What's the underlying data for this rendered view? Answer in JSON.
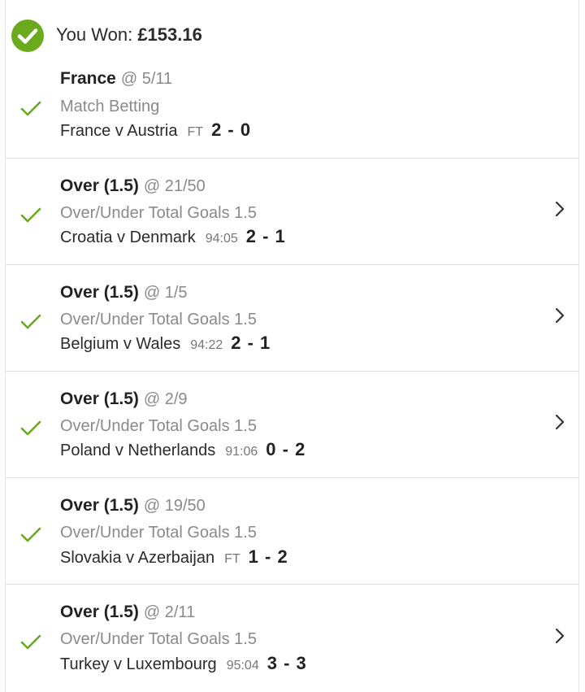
{
  "header": {
    "label": "You Won:",
    "amount": "£153.16"
  },
  "colors": {
    "accent_green": "#6aaa1c",
    "muted_text": "#8a8a8a",
    "divider": "#e0e0e0"
  },
  "bets": [
    {
      "selection": "France",
      "odds": "@ 5/11",
      "market": "Match Betting",
      "match": "France v Austria",
      "clock": "FT",
      "score": "2 - 0",
      "has_chevron": false
    },
    {
      "selection": "Over (1.5)",
      "odds": "@ 21/50",
      "market": "Over/Under Total Goals 1.5",
      "match": "Croatia v Denmark",
      "clock": "94:05",
      "score": "2 - 1",
      "has_chevron": true
    },
    {
      "selection": "Over (1.5)",
      "odds": "@ 1/5",
      "market": "Over/Under Total Goals 1.5",
      "match": "Belgium v Wales",
      "clock": "94:22",
      "score": "2 - 1",
      "has_chevron": true
    },
    {
      "selection": "Over (1.5)",
      "odds": "@ 2/9",
      "market": "Over/Under Total Goals 1.5",
      "match": "Poland v Netherlands",
      "clock": "91:06",
      "score": "0 - 2",
      "has_chevron": true
    },
    {
      "selection": "Over (1.5)",
      "odds": "@ 19/50",
      "market": "Over/Under Total Goals 1.5",
      "match": "Slovakia v Azerbaijan",
      "clock": "FT",
      "score": "1 - 2",
      "has_chevron": false
    },
    {
      "selection": "Over (1.5)",
      "odds": "@ 2/11",
      "market": "Over/Under Total Goals 1.5",
      "match": "Turkey v Luxembourg",
      "clock": "95:04",
      "score": "3 - 3",
      "has_chevron": true
    }
  ]
}
